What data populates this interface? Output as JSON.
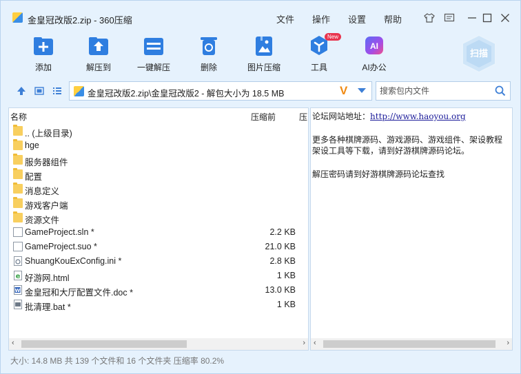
{
  "window": {
    "title": "金皇冠改版2.zip - 360压缩",
    "menu": [
      "文件",
      "操作",
      "设置",
      "帮助"
    ]
  },
  "toolbar": {
    "tools": [
      {
        "label": "添加",
        "icon": "add-icon"
      },
      {
        "label": "解压到",
        "icon": "extract-to-icon"
      },
      {
        "label": "一键解压",
        "icon": "one-click-extract-icon"
      },
      {
        "label": "删除",
        "icon": "trash-icon"
      },
      {
        "label": "图片压缩",
        "icon": "image-compress-icon"
      },
      {
        "label": "工具",
        "icon": "tools-icon",
        "badge": "New"
      },
      {
        "label": "AI办公",
        "icon": "ai-office-icon",
        "icon_text": "AI"
      }
    ],
    "scan_label": "扫描"
  },
  "address": {
    "path": "金皇冠改版2.zip\\金皇冠改版2 - 解包大小为 18.5 MB",
    "v_mark": "V",
    "search_placeholder": "搜索包内文件"
  },
  "filelist": {
    "headers": {
      "name": "名称",
      "compressed": "压缩前",
      "col3": "压"
    },
    "rows": [
      {
        "name": ".. (上级目录)",
        "size": "",
        "type": "folder"
      },
      {
        "name": "hge",
        "size": "",
        "type": "folder"
      },
      {
        "name": "服务器组件",
        "size": "",
        "type": "folder"
      },
      {
        "name": "配置",
        "size": "",
        "type": "folder"
      },
      {
        "name": "消息定义",
        "size": "",
        "type": "folder"
      },
      {
        "name": "游戏客户端",
        "size": "",
        "type": "folder"
      },
      {
        "name": "资源文件",
        "size": "",
        "type": "folder"
      },
      {
        "name": "GameProject.sln *",
        "size": "2.2 KB",
        "type": "file"
      },
      {
        "name": "GameProject.suo *",
        "size": "21.0 KB",
        "type": "file"
      },
      {
        "name": "ShuangKouExConfig.ini *",
        "size": "2.8 KB",
        "type": "ini"
      },
      {
        "name": "好游网.html",
        "size": "1 KB",
        "type": "html"
      },
      {
        "name": "金皇冠和大厅配置文件.doc *",
        "size": "13.0 KB",
        "type": "doc"
      },
      {
        "name": "批清理.bat *",
        "size": "1 KB",
        "type": "bat"
      }
    ]
  },
  "preview": {
    "label1": "论坛网站地址：",
    "url": "http://www.haoyou.org",
    "line2": "更多各种棋牌源码、游戏源码、游戏组件、架设教程",
    "line3": "架设工具等下载，请到好游棋牌源码论坛。",
    "line4": "解压密码请到好游棋牌源码论坛查找"
  },
  "status": {
    "text": "大小: 14.8 MB 共 139 个文件和 16 个文件夹 压缩率 80.2%"
  },
  "colors": {
    "accent": "#3d86e0",
    "window_bg": "#e6f2fd",
    "folder": "#f8cf5f",
    "badge": "#e8344e",
    "v_mark": "#f08a12"
  }
}
